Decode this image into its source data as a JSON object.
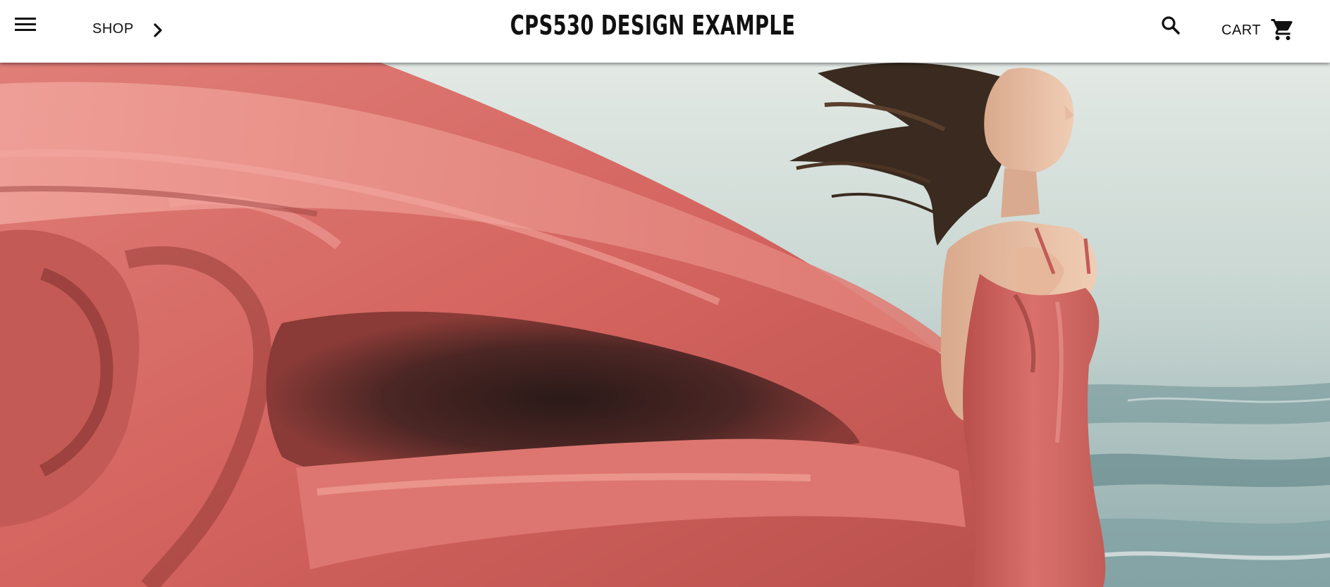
{
  "header": {
    "menu_icon": "hamburger-menu-icon",
    "shop_label": "SHOP",
    "shop_icon": "chevron-right-icon",
    "title": "CPS530 DESIGN EXAMPLE",
    "search_icon": "search-icon",
    "cart_label": "CART",
    "cart_icon": "shopping-cart-icon"
  },
  "hero": {
    "image": "woman-in-flowing-red-dress-by-sea",
    "colors": {
      "fabric": "#d9706b",
      "fabric_shadow": "#8e3a36",
      "sea": "#a9c1c0",
      "sea_dark": "#6f8f92",
      "sky": "#dfe6e1"
    }
  }
}
